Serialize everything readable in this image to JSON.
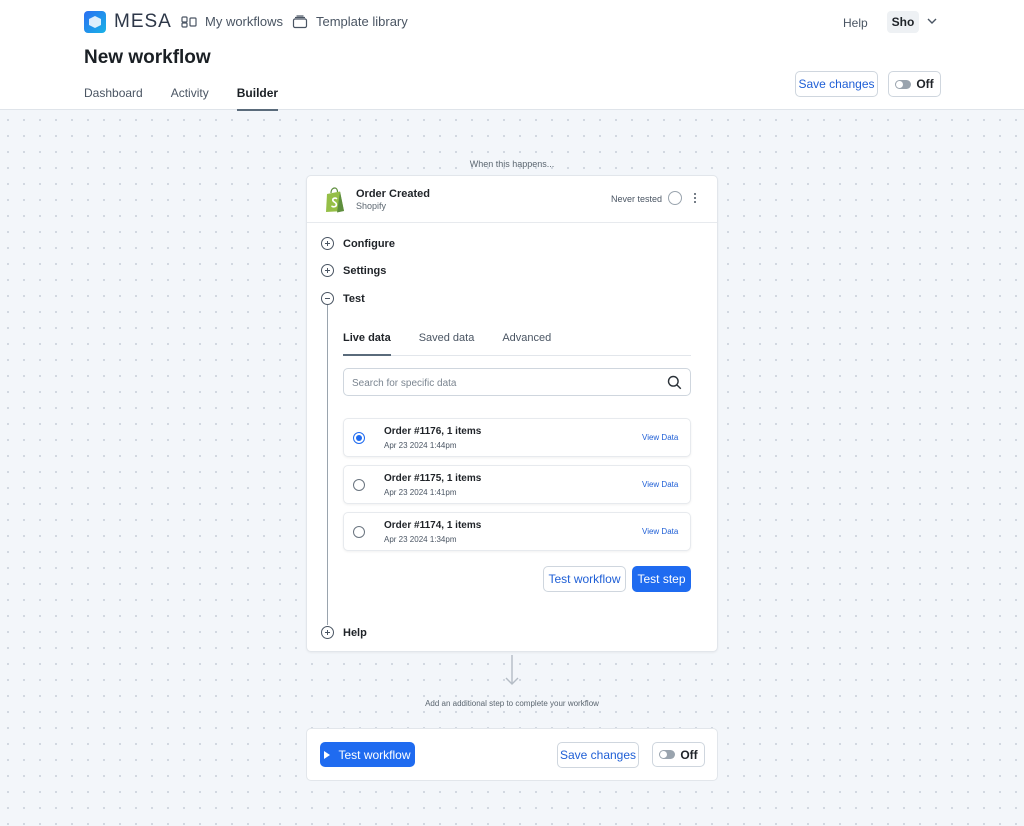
{
  "header": {
    "brand": "MESA",
    "nav": [
      {
        "label": "My workflows",
        "icon": "workflows-icon"
      },
      {
        "label": "Template library",
        "icon": "library-icon"
      }
    ],
    "help": "Help",
    "user": "Sho",
    "page_title": "New workflow",
    "tabs": [
      {
        "label": "Dashboard",
        "active": false
      },
      {
        "label": "Activity",
        "active": false
      },
      {
        "label": "Builder",
        "active": true
      }
    ],
    "save_label": "Save changes",
    "toggle_label": "Off"
  },
  "canvas": {
    "trigger_caption": "When this happens...",
    "trigger": {
      "title": "Order Created",
      "app": "Shopify",
      "status": "Never tested"
    },
    "sections": {
      "configure": "Configure",
      "settings": "Settings",
      "test": "Test",
      "help": "Help"
    },
    "test_tabs": [
      "Live data",
      "Saved data",
      "Advanced"
    ],
    "search_placeholder": "Search for specific data",
    "orders": [
      {
        "title": "Order #1176, 1 items",
        "date": "Apr 23 2024 1:44pm",
        "selected": true
      },
      {
        "title": "Order #1175, 1 items",
        "date": "Apr 23 2024 1:41pm",
        "selected": false
      },
      {
        "title": "Order #1174, 1 items",
        "date": "Apr 23 2024 1:34pm",
        "selected": false
      }
    ],
    "view_data_label": "View Data",
    "test_workflow_label": "Test workflow",
    "test_step_label": "Test step",
    "add_step_caption": "Add an additional step to complete your workflow"
  },
  "footer": {
    "test_workflow_label": "Test workflow",
    "save_label": "Save changes",
    "toggle_label": "Off"
  },
  "colors": {
    "accent": "#1f6bf0",
    "link": "#1f5fd6",
    "shopify": "#95bf47"
  }
}
